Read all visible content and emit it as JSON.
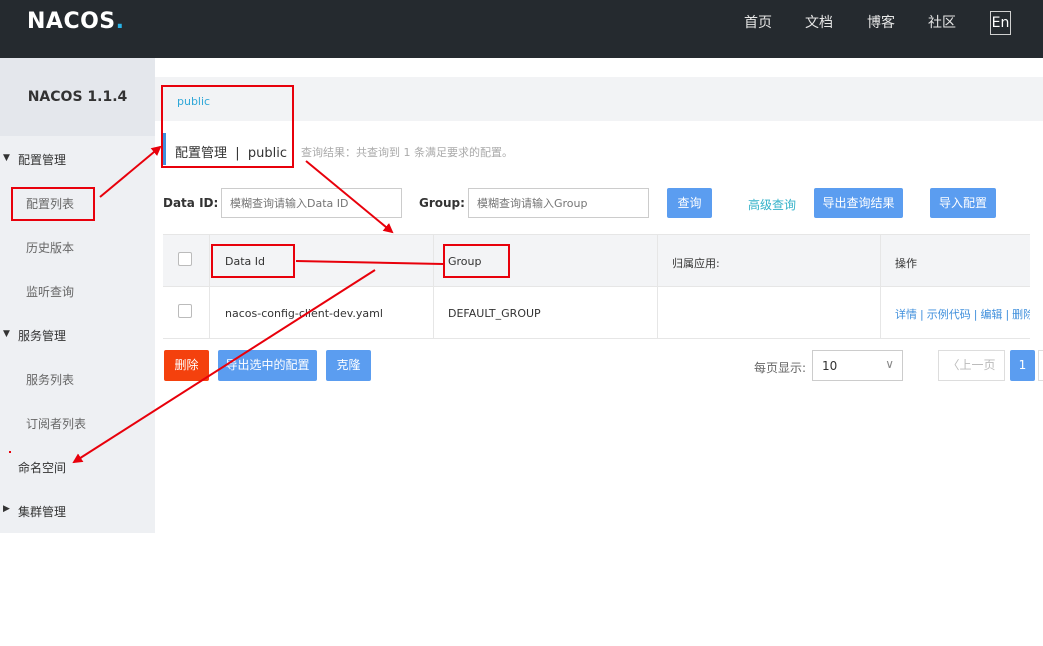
{
  "header": {
    "logo_main": "NACOS",
    "logo_dot": ".",
    "nav": [
      "首页",
      "文档",
      "博客",
      "社区"
    ],
    "lang": "En"
  },
  "sidebar": {
    "version": "NACOS 1.1.4",
    "groups": [
      {
        "label": "配置管理",
        "items": [
          "配置列表",
          "历史版本",
          "监听查询"
        ]
      },
      {
        "label": "服务管理",
        "items": [
          "服务列表",
          "订阅者列表"
        ]
      },
      {
        "label": "命名空间"
      },
      {
        "label": "集群管理"
      }
    ]
  },
  "main": {
    "breadcrumb": "public",
    "title": "配置管理  |  public",
    "query_info": "查询结果：共查询到 1 条满足要求的配置。",
    "filters": {
      "data_id_label": "Data ID:",
      "data_id_placeholder": "模糊查询请输入Data ID",
      "group_label": "Group:",
      "group_placeholder": "模糊查询请输入Group"
    },
    "buttons": {
      "query": "查询",
      "advanced": "高级查询",
      "export_results": "导出查询结果",
      "import": "导入配置",
      "delete": "删除",
      "export_selected": "导出选中的配置",
      "clone": "克隆"
    },
    "table": {
      "columns": [
        "Data Id",
        "Group",
        "归属应用:",
        "操作"
      ],
      "rows": [
        {
          "data_id": "nacos-config-client-dev.yaml",
          "group": "DEFAULT_GROUP",
          "app": "",
          "ops": [
            "详情",
            "示例代码",
            "编辑",
            "删除"
          ]
        }
      ]
    },
    "pagination": {
      "page_size_label": "每页显示:",
      "page_size": "10",
      "prev": "上一页",
      "current_page": "1"
    }
  },
  "colors": {
    "header_bg": "#252a2f",
    "accent": "#5b9df0",
    "danger": "#f4410d",
    "annotation": "#e8000b"
  }
}
